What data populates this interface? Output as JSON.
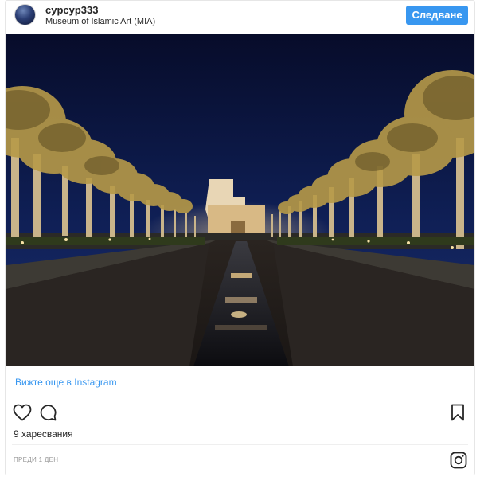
{
  "post": {
    "username": "cypcyp333",
    "location": "Museum of Islamic Art (MIA)",
    "follow_label": "Следване",
    "view_more_label": "Вижте още в Instagram",
    "likes_label": "9 харесвания",
    "timestamp_label": "ПРЕДИ 1 ДЕН"
  },
  "icons": {
    "heart": "heart-icon",
    "comment": "comment-icon",
    "bookmark": "bookmark-icon",
    "instagram": "instagram-icon"
  },
  "colors": {
    "accent": "#3897f0",
    "text": "#262626",
    "muted": "#999999",
    "border": "#e6e6e6"
  }
}
